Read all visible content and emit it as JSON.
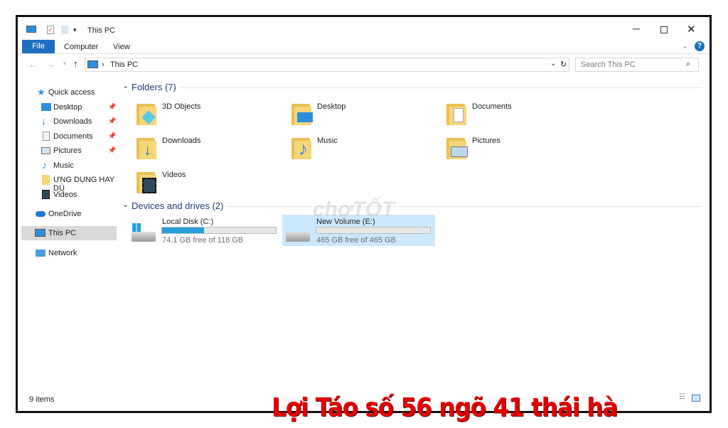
{
  "window": {
    "title": "This PC"
  },
  "ribbon": {
    "tabs": [
      "File",
      "Computer",
      "View"
    ],
    "help": "?"
  },
  "address": {
    "path": "This PC",
    "search_placeholder": "Search This PC"
  },
  "sidebar": {
    "items": [
      {
        "label": "Quick access",
        "icon": "star-icon"
      },
      {
        "label": "Desktop",
        "icon": "desktop-icon",
        "pinned": true
      },
      {
        "label": "Downloads",
        "icon": "download-icon",
        "pinned": true
      },
      {
        "label": "Documents",
        "icon": "documents-icon",
        "pinned": true
      },
      {
        "label": "Pictures",
        "icon": "pictures-icon",
        "pinned": true
      },
      {
        "label": "Music",
        "icon": "music-icon"
      },
      {
        "label": "ỨNG DỤNG HAY DÙ",
        "icon": "folder-icon"
      },
      {
        "label": "Videos",
        "icon": "videos-icon"
      },
      {
        "label": "OneDrive",
        "icon": "cloud-icon"
      },
      {
        "label": "This PC",
        "icon": "computer-icon",
        "selected": true
      },
      {
        "label": "Network",
        "icon": "network-icon"
      }
    ]
  },
  "folders": {
    "header": "Folders (7)",
    "items": [
      "3D Objects",
      "Desktop",
      "Documents",
      "Downloads",
      "Music",
      "Pictures",
      "Videos"
    ]
  },
  "drives": {
    "header": "Devices and drives (2)",
    "items": [
      {
        "name": "Local Disk (C:)",
        "info": "74.1 GB free of 118 GB",
        "used_fraction": 0.37
      },
      {
        "name": "New Volume (E:)",
        "info": "465 GB free of 465 GB",
        "used_fraction": 0.0,
        "selected": true
      }
    ]
  },
  "status": {
    "count": "9 items"
  },
  "watermark": "chợTỐT",
  "caption": "Lợi Táo số 56 ngõ 41 thái hà",
  "colors": {
    "accent": "#1e6fbf",
    "selection": "#cce8ff",
    "caption": "#e50000",
    "bar_fill": "#26a0da"
  }
}
